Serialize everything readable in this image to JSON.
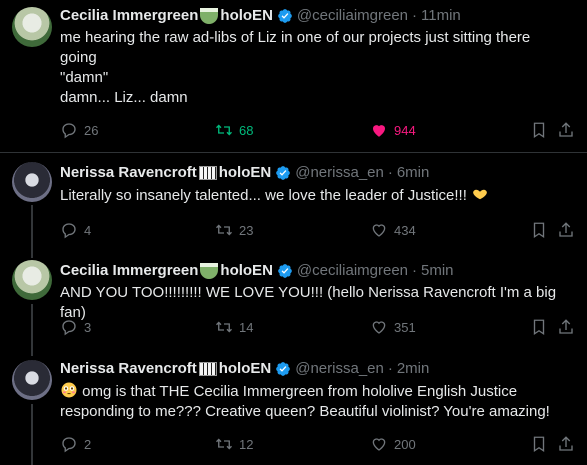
{
  "tweets": [
    {
      "name": "Cecilia Immergreen",
      "suffix": "holoEN",
      "handle": "@ceciliaimgreen",
      "dot": "·",
      "time": "11min",
      "lines": [
        "me hearing the raw ad-libs of Liz in one of our projects just sitting there",
        "going",
        "\"damn\"",
        "damn... Liz... damn"
      ],
      "replies": "26",
      "reposts": "68",
      "likes": "944"
    },
    {
      "name": "Nerissa Ravencroft",
      "suffix": "holoEN",
      "handle": "@nerissa_en",
      "dot": "·",
      "time": "6min",
      "lines": [
        "Literally so insanely talented... we love the leader of Justice!!! "
      ],
      "replies": "4",
      "reposts": "23",
      "likes": "434"
    },
    {
      "name": "Cecilia Immergreen",
      "suffix": "holoEN",
      "handle": "@ceciliaimgreen",
      "dot": "·",
      "time": "5min",
      "lines": [
        "AND YOU TOO!!!!!!!!! WE LOVE YOU!!! (hello Nerissa Ravencroft I'm a big fan)"
      ],
      "replies": "3",
      "reposts": "14",
      "likes": "351"
    },
    {
      "name": "Nerissa Ravencroft",
      "suffix": "holoEN",
      "handle": "@nerissa_en",
      "dot": "·",
      "time": "2min",
      "lines": [
        " omg is that THE Cecilia Immergreen from hololive English Justice",
        "responding to me??? Creative queen? Beautiful violinist? You're amazing!"
      ],
      "replies": "2",
      "reposts": "12",
      "likes": "200"
    }
  ],
  "colors": {
    "background": "#000000",
    "text": "#e7e9ea",
    "muted": "#71767b",
    "verified": "#1d9bf0",
    "repost_active": "#00ba7c",
    "like_active": "#f91880"
  },
  "icons": [
    "reply-icon",
    "repost-icon",
    "like-icon",
    "bookmark-icon",
    "share-icon",
    "verified-icon"
  ]
}
